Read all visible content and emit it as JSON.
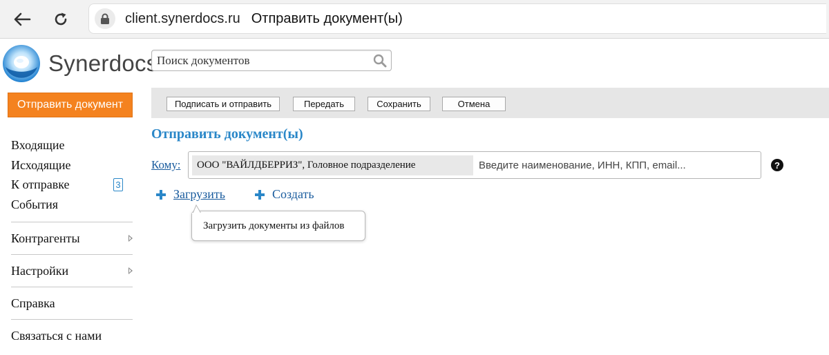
{
  "browser": {
    "url": "client.synerdocs.ru",
    "page_title": "Отправить документ(ы)"
  },
  "app": {
    "logo_text": "Synerdocs",
    "brand_color": "#f4821f",
    "accent_color": "#2a87c8"
  },
  "search": {
    "placeholder": "Поиск документов"
  },
  "sidebar": {
    "send_button": "Отправить документ",
    "folders": [
      {
        "label": "Входящие"
      },
      {
        "label": "Исходящие"
      },
      {
        "label": "К отправке",
        "badge": "3"
      },
      {
        "label": "События"
      }
    ],
    "links": [
      {
        "label": "Контрагенты"
      },
      {
        "label": "Настройки"
      },
      {
        "label": "Справка"
      },
      {
        "label": "Связаться с нами"
      }
    ]
  },
  "toolbar": {
    "sign_send": "Подписать и отправить",
    "transfer": "Передать",
    "save": "Сохранить",
    "cancel": "Отмена"
  },
  "main": {
    "heading": "Отправить документ(ы)",
    "to_label": "Кому:",
    "recipient_chip": "ООО \"ВАЙЛДБЕРРИЗ\", Головное подразделение",
    "recipient_placeholder": "Введите наименование, ИНН, КПП, email...",
    "help_label": "?",
    "upload_label": "Загрузить",
    "create_label": "Создать",
    "tooltip": "Загрузить документы из файлов"
  }
}
